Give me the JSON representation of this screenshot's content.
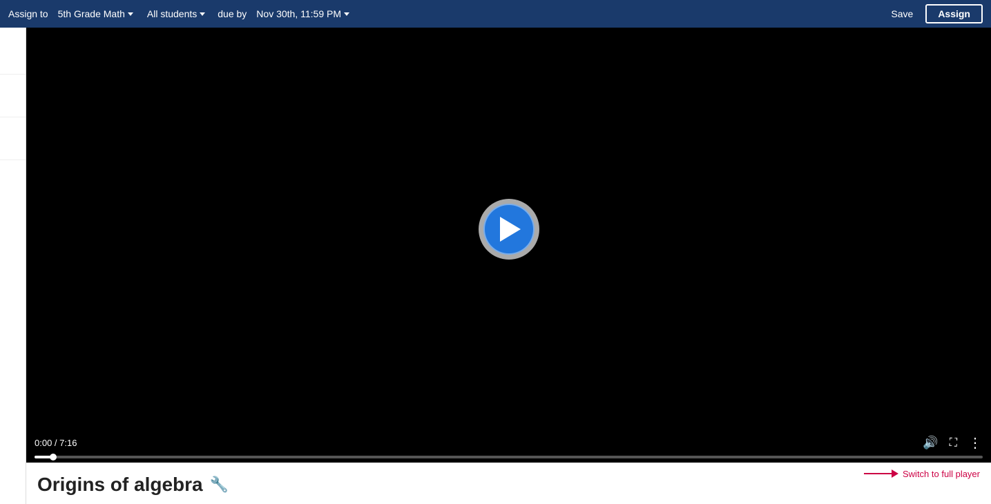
{
  "topbar": {
    "assign_to_label": "Assign to",
    "class_dropdown": "5th Grade Math",
    "students_dropdown": "All students",
    "due_by_label": "due by",
    "due_date_dropdown": "Nov 30th, 11:59 PM",
    "save_label": "Save",
    "assign_label": "Assign"
  },
  "video": {
    "time_current": "0:00",
    "time_total": "7:16",
    "time_display": "0:00 / 7:16",
    "progress_percent": 2
  },
  "below_video": {
    "switch_to_full_label": "Switch to full player",
    "title": "Origins of algebra",
    "wrench_icon": "🔧"
  }
}
